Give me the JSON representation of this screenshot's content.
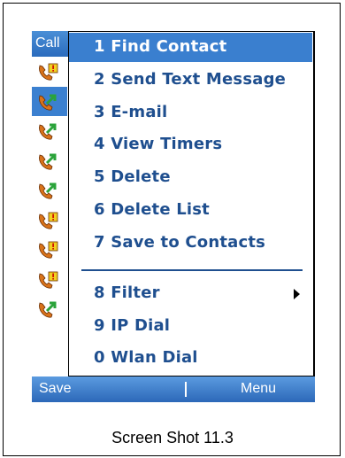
{
  "title_bar": {
    "text": "Call"
  },
  "call_list": [
    {
      "type": "missed",
      "icon": "missed-call-icon"
    },
    {
      "type": "outgoing",
      "icon": "outgoing-call-icon",
      "selected": true
    },
    {
      "type": "outgoing",
      "icon": "outgoing-call-icon"
    },
    {
      "type": "outgoing",
      "icon": "outgoing-call-icon"
    },
    {
      "type": "outgoing",
      "icon": "outgoing-call-icon"
    },
    {
      "type": "missed",
      "icon": "missed-call-icon"
    },
    {
      "type": "missed",
      "icon": "missed-call-icon"
    },
    {
      "type": "missed",
      "icon": "missed-call-icon"
    },
    {
      "type": "outgoing",
      "icon": "outgoing-call-icon"
    }
  ],
  "menu": {
    "items": [
      {
        "label": "1 Find Contact"
      },
      {
        "label": "2 Send Text Message"
      },
      {
        "label": "3 E-mail"
      },
      {
        "label": "4 View Timers"
      },
      {
        "label": "5 Delete"
      },
      {
        "label": "6 Delete List"
      },
      {
        "label": "7 Save to Contacts"
      },
      {
        "label": "8 Filter"
      },
      {
        "label": "9 IP Dial"
      },
      {
        "label": "0 Wlan Dial"
      }
    ],
    "highlighted_index": 0
  },
  "softkeys": {
    "left": "Save",
    "right": "Menu"
  },
  "caption": "Screen Shot 11.3",
  "colors": {
    "title_bar": "#2f73c5",
    "highlight": "#3a7fcf",
    "menu_text": "#1f4f8f",
    "phone_handset": "#d9731a",
    "missed_badge": "#f2d020",
    "outgoing_arrow": "#2aa33a"
  }
}
